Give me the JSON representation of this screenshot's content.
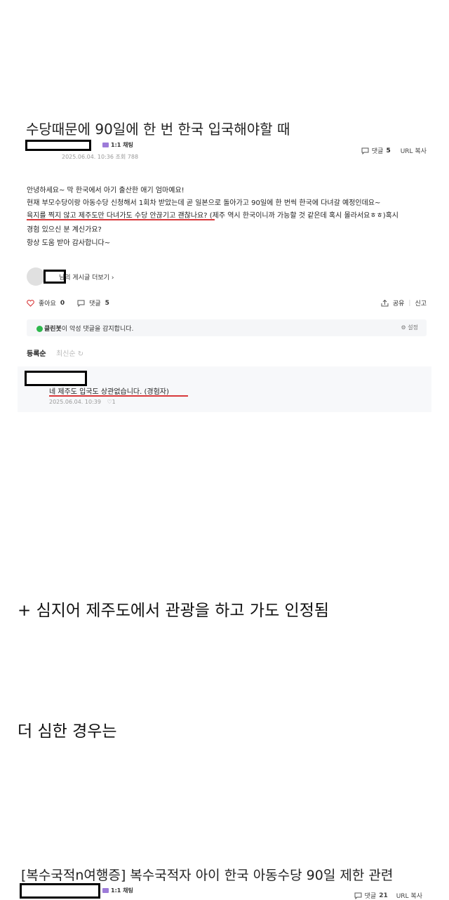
{
  "post": {
    "title": "수당때문에 90일에 한 번 한국 입국해야할 때",
    "chat_label": "1:1 채팅",
    "date": "2025.06.04. 10:36",
    "views_label": "조회 788",
    "comment_label": "댓글",
    "comment_count": "5",
    "url_copy": "URL 복사",
    "lines": [
      "안녕하세요~ 막 한국에서 아기 출산한 애기 엄마예요!",
      "현재 부모수당이랑 아동수당 신청해서 1회차 받았는데 곧 일본으로 돌아가고 90일에 한 번씩 한국에 다녀갈 예정인데요~",
      "육지를 찍지 않고 제주도만 다녀가도 수당 안끊기고 괜찮나요? (제주 역시 한국이니까 가능할 것 같은데 혹시 몰라서요ㅎㅎ)혹시",
      "경험 있으신 분 계신가요?",
      "항상 도움 받아 감사합니다~"
    ],
    "more_posts": "님의 게시글 더보기",
    "more_chevron": "›"
  },
  "actions": {
    "like_label": "좋아요",
    "like_count": "0",
    "comment_label": "댓글",
    "comment_count": "5",
    "share": "공유",
    "report": "신고"
  },
  "cleanbot": {
    "name": "클린봇",
    "message": "이 악성 댓글을 감지합니다.",
    "settings": "설정"
  },
  "sort": {
    "registered": "등록순",
    "latest": "최신순"
  },
  "comment": {
    "text": "네 제주도 입국도 상관없습니다. (경험자)",
    "date": "2025.06.04. 10:39",
    "likes": "1"
  },
  "captions": {
    "note": "+ 심지어 제주도에서 관광을 하고 가도 인정됨",
    "worse": "더 심한 경우는"
  },
  "post2": {
    "title": "[복수국적n여행증] 복수국적자 아이 한국 아동수당 90일 제한 관련",
    "chat_label": "1:1 채팅",
    "comment_label": "댓글",
    "comment_count": "21",
    "url_copy": "URL 복사"
  },
  "colors": {
    "underline": "#d8383a",
    "cleanbot_green": "#2db84c",
    "chat_purple": "#9d7bd8"
  }
}
